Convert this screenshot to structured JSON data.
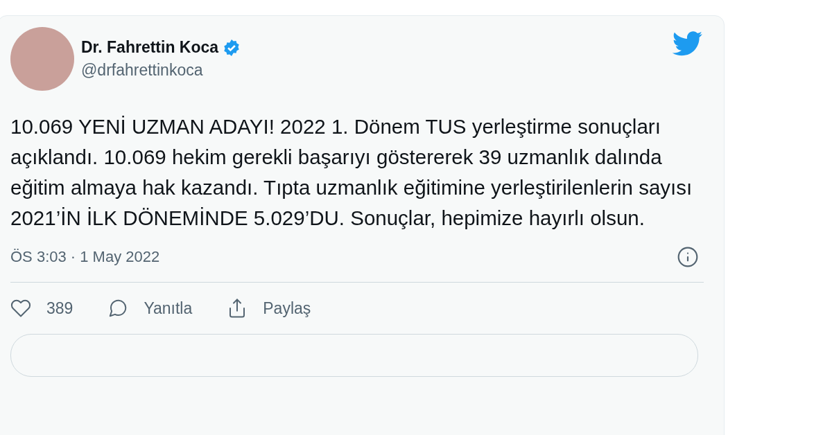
{
  "author": {
    "name": "Dr. Fahrettin Koca",
    "verified": true,
    "handle": "@drfahrettinkoca"
  },
  "text": "10.069 YENİ UZMAN ADAYI! 2022 1. Dönem TUS yerleştirme sonuçları açıklandı. 10.069 hekim gerekli başarıyı göstererek 39 uzmanlık dalında eğitim almaya hak kazandı. Tıpta uzmanlık eğitimine yerleştirilenlerin sayısı 2021’İN İLK DÖNEMİNDE 5.029’DU. Sonuçlar, hepimize hayırlı olsun.",
  "timestamp": "ÖS 3:03 · 1 May 2022",
  "actions": [
    {
      "kind": "like",
      "label": "389"
    },
    {
      "kind": "reply",
      "label": "Yanıtla"
    },
    {
      "kind": "share",
      "label": "Paylaş"
    }
  ]
}
